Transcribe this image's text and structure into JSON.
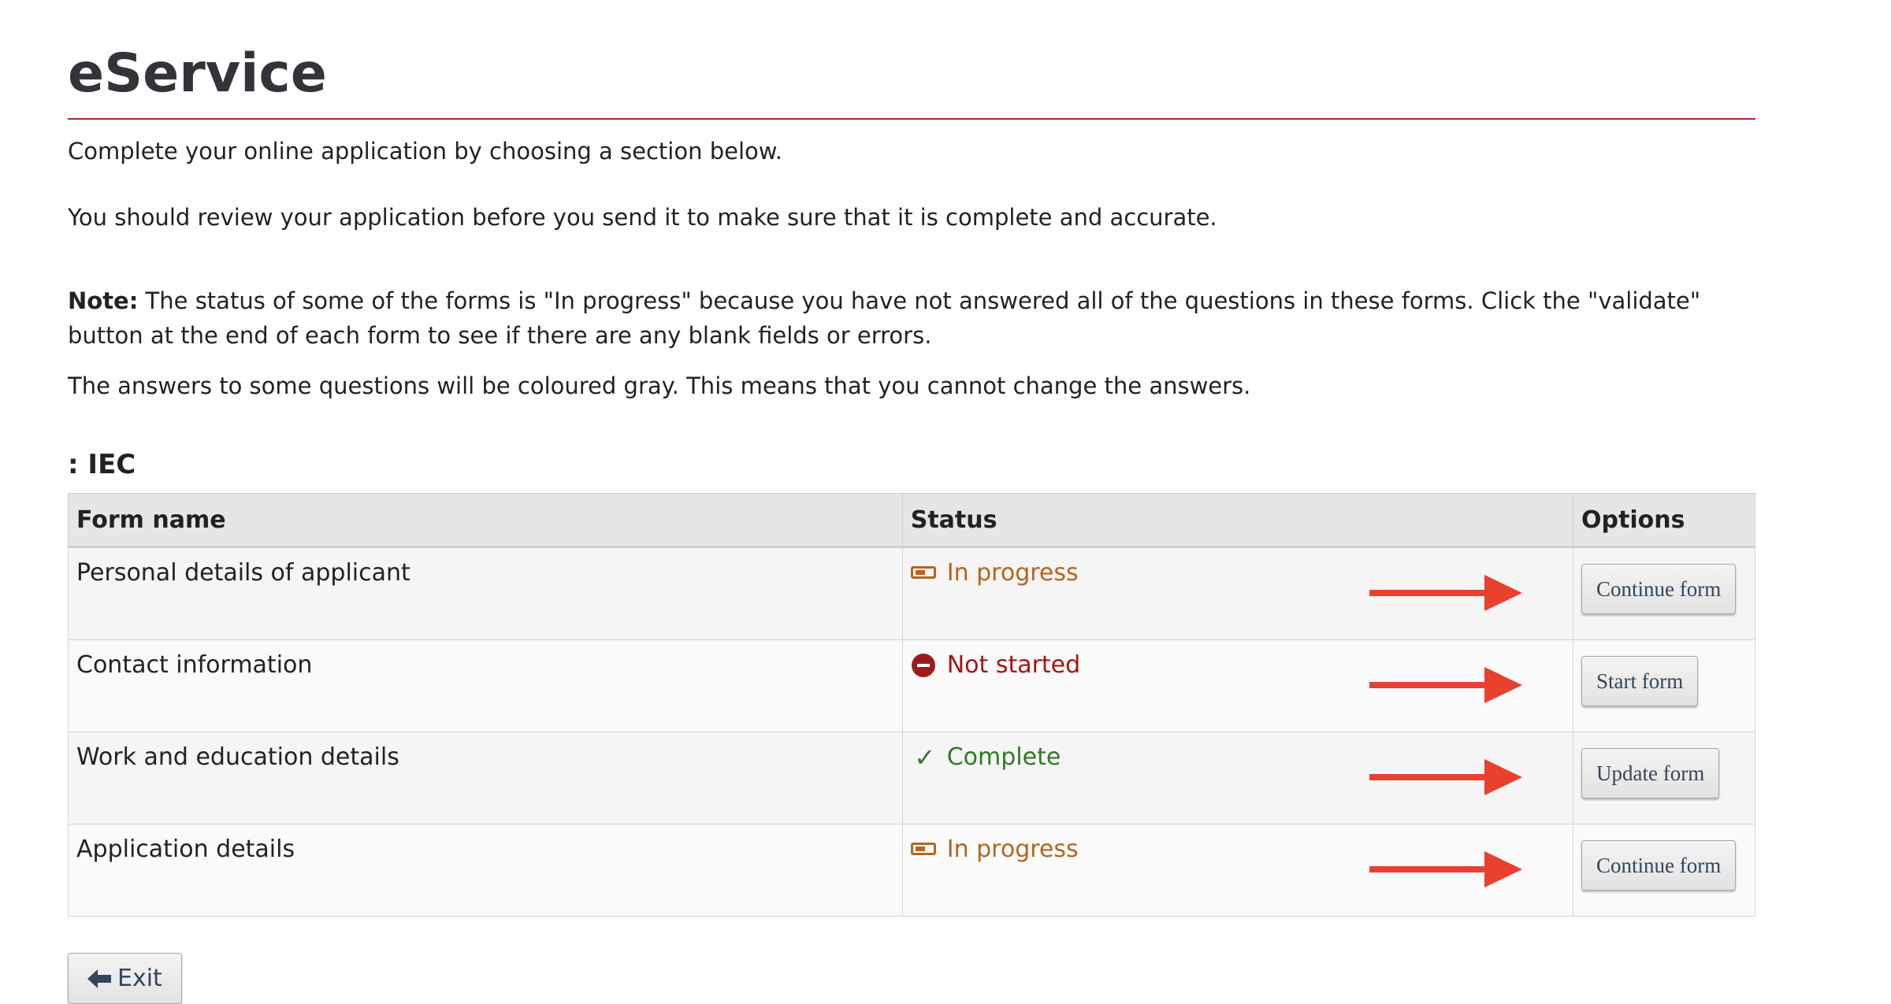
{
  "page": {
    "title": "eService",
    "intro": "Complete your online application by choosing a section below.",
    "review": "You should review your application before you send it to make sure that it is complete and accurate.",
    "note_label": "Note:",
    "note_text": " The status of some of the forms is \"In progress\" because you have not answered all of the questions in these forms. Click the \"validate\" button at the end of each form to see if there are any blank fields or errors.",
    "gray_note": "The answers to some questions will be coloured gray. This means that you cannot change the answers.",
    "section_title": ": IEC"
  },
  "table": {
    "headers": {
      "name": "Form name",
      "status": "Status",
      "options": "Options"
    },
    "rows": [
      {
        "name": "Personal details of applicant",
        "status": "In progress",
        "status_icon": "in-progress-icon",
        "action": "Continue form"
      },
      {
        "name": "Contact information",
        "status": "Not started",
        "status_icon": "not-started-icon",
        "action": "Start form"
      },
      {
        "name": "Work and education details",
        "status": "Complete",
        "status_icon": "check-icon",
        "action": "Update form"
      },
      {
        "name": "Application details",
        "status": "In progress",
        "status_icon": "in-progress-icon",
        "action": "Continue form"
      }
    ]
  },
  "footer": {
    "exit_label": "Exit",
    "exit_icon": "arrow-left-icon"
  },
  "colors": {
    "title_rule": "#b3282d",
    "in_progress": "#b5651d",
    "not_started": "#a31515",
    "complete": "#2f7a25",
    "arrow": "#e8412e",
    "button_text": "#34465a"
  }
}
